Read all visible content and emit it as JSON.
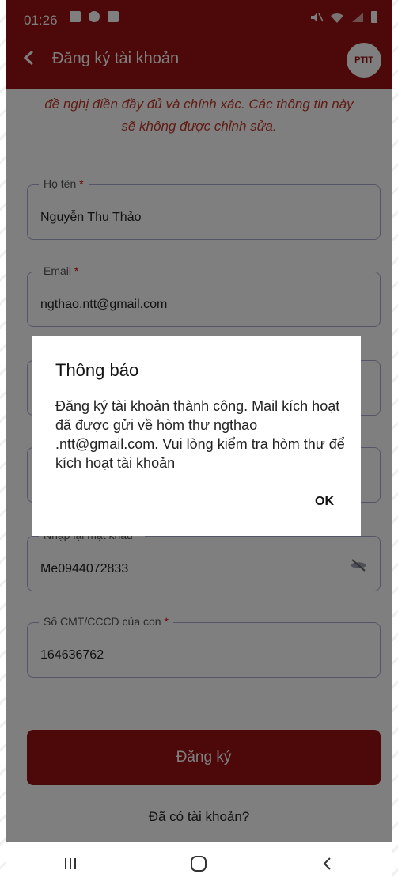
{
  "status_bar": {
    "time": "01:26"
  },
  "app_bar": {
    "title": "Đăng ký tài khoản",
    "logo_text": "PTIT"
  },
  "notice": {
    "line1": "đề nghị điền đầy đủ và chính xác. Các thông tin này",
    "line2": "sẽ không được chỉnh sửa."
  },
  "fields": [
    {
      "label": "Họ tên",
      "required_mark": "*",
      "value": "Nguyễn Thu Thảo"
    },
    {
      "label": "Email",
      "required_mark": "*",
      "value": "ngthao.ntt@gmail.com"
    },
    {
      "label": "Nhập lại mật khẩu",
      "required_mark": "*",
      "value": "Me0944072833"
    },
    {
      "label": "Số CMT/CCCD của con",
      "required_mark": "*",
      "value": "164636762"
    }
  ],
  "register_button": "Đăng ký",
  "login_link": "Đã có tài khoản?",
  "dialog": {
    "title": "Thông báo",
    "message": "Đăng ký tài khoản thành công. Mail kích hoạt đã được gửi về hòm thư ngthao .ntt@gmail.com. Vui lòng kiểm tra hòm thư để kích hoạt tài khoản",
    "ok": "OK"
  },
  "colors": {
    "brand": "#9a1212",
    "notice": "#c0392b",
    "field_border": "#a9acd0"
  },
  "icons": [
    "back-arrow-icon",
    "eye-off-icon",
    "recents-icon",
    "home-icon",
    "back-nav-icon"
  ]
}
